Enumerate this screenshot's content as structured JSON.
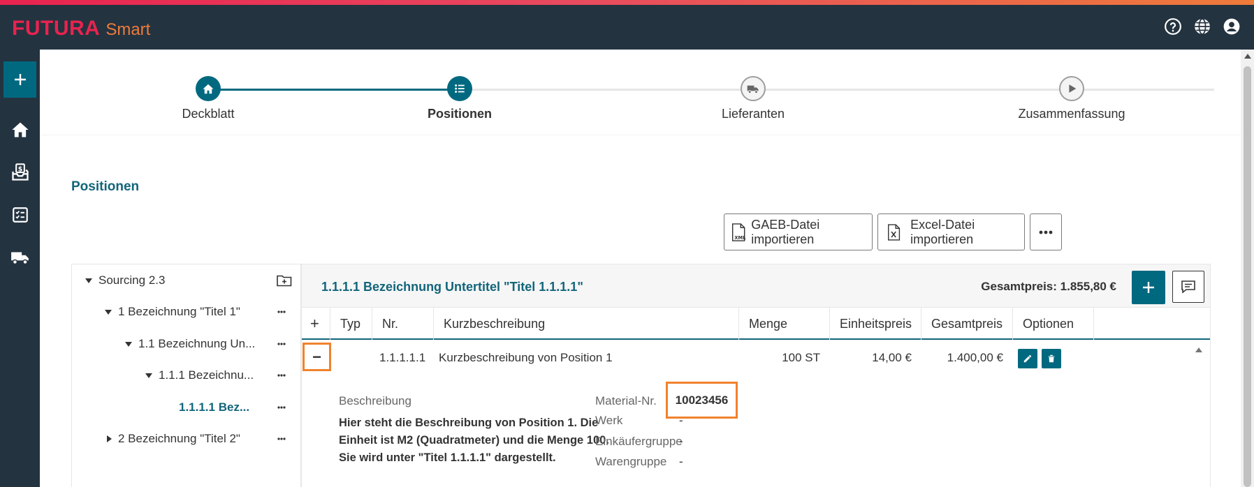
{
  "brand": {
    "main": "FUTURA",
    "sub": "Smart"
  },
  "colors": {
    "accent": "#006980",
    "highlight": "#f0822d",
    "header_bg": "#243340",
    "brand_red": "#e8234f",
    "brand_orange": "#ee7b3a"
  },
  "header_icons": [
    "help-icon",
    "globe-icon",
    "account-icon"
  ],
  "rail_icons": [
    "plus-icon",
    "home-icon",
    "inbox-dollar-icon",
    "checklist-icon",
    "truck-icon"
  ],
  "stepper": {
    "steps": [
      {
        "label": "Deckblatt",
        "icon": "home-icon",
        "state": "done"
      },
      {
        "label": "Positionen",
        "icon": "list-icon",
        "state": "current"
      },
      {
        "label": "Lieferanten",
        "icon": "truck-icon",
        "state": "upcoming"
      },
      {
        "label": "Zusammenfassung",
        "icon": "play-icon",
        "state": "upcoming"
      }
    ]
  },
  "section_title": "Positionen",
  "toolbar": {
    "view_modes": [
      "table-icon",
      "hierarchy-icon"
    ],
    "selected_view": "hierarchy",
    "gaeb_label": "GAEB-Datei importieren",
    "excel_label": "Excel-Datei importieren"
  },
  "tree": {
    "root": "Sourcing 2.3",
    "items": [
      {
        "label": "1 Bezeichnung \"Titel 1\""
      },
      {
        "label": "1.1 Bezeichnung Un..."
      },
      {
        "label": "1.1.1 Bezeichnu..."
      },
      {
        "label": "1.1.1.1 Bez..."
      },
      {
        "label": "2 Bezeichnung \"Titel 2\""
      }
    ]
  },
  "panel": {
    "title": "1.1.1.1 Bezeichnung Untertitel \"Titel 1.1.1.1\"",
    "total": "Gesamtpreis: 1.855,80 €",
    "columns": {
      "add": "+",
      "typ": "Typ",
      "nr": "Nr.",
      "kurz": "Kurzbeschreibung",
      "menge": "Menge",
      "einheitspreis": "Einheitspreis",
      "gesamtpreis": "Gesamtpreis",
      "optionen": "Optionen"
    },
    "row": {
      "collapse": "−",
      "nr": "1.1.1.1.1",
      "kurz": "Kurzbeschreibung von Position 1",
      "menge": "100 ST",
      "einheitspreis": "14,00 €",
      "gesamtpreis": "1.400,00 €"
    },
    "details": {
      "beschreibung_label": "Beschreibung",
      "beschreibung_text": "Hier steht die Beschreibung von Position 1. Die Einheit ist M2 (Quadratmeter) und die Menge 100. Sie wird unter \"Titel 1.1.1.1\" dargestellt.",
      "material_label": "Material-Nr.",
      "material_value": "10023456",
      "werk_label": "Werk",
      "werk_value": "-",
      "einkaeufer_label": "Einkäufergruppe",
      "einkaeufer_value": "-",
      "waren_label": "Warengruppe",
      "waren_value": "-"
    }
  }
}
